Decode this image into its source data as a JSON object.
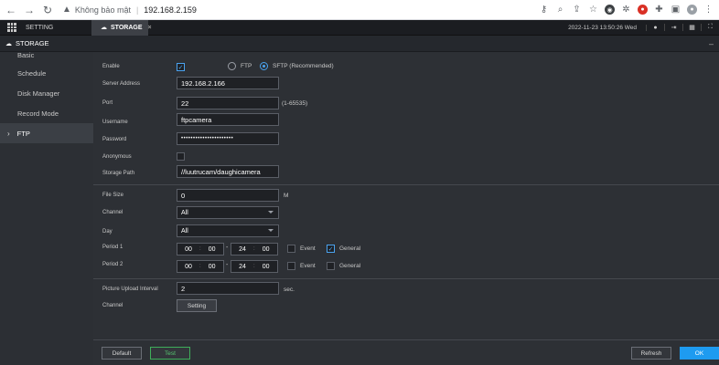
{
  "browser": {
    "security_label": "Không bảo mật",
    "url": "192.168.2.159",
    "icons": [
      "back-icon",
      "forward-icon",
      "reload-icon",
      "warning-icon",
      "key-icon",
      "zoom-icon",
      "share-icon",
      "star-icon",
      "extension-icon",
      "puzzle-icon",
      "sidepanel-icon",
      "profile-icon",
      "menu-icon"
    ]
  },
  "app": {
    "tabs": [
      {
        "label": "SETTING"
      },
      {
        "label": "STORAGE",
        "close": "×"
      }
    ],
    "datetime": "2022-11-23 13:50:26 Wed",
    "page_title": "STORAGE"
  },
  "sidebar": {
    "items": [
      {
        "label": "Basic"
      },
      {
        "label": "Schedule"
      },
      {
        "label": "Disk Manager"
      },
      {
        "label": "Record Mode"
      },
      {
        "label": "FTP"
      }
    ]
  },
  "form": {
    "enable_label": "Enable",
    "ftp_label": "FTP",
    "sftp_label": "SFTP (Recommended)",
    "server_label": "Server Address",
    "server_value": "192.168.2.166",
    "port_label": "Port",
    "port_value": "22",
    "port_hint": "(1-65535)",
    "username_label": "Username",
    "username_value": "ftpcamera",
    "password_label": "Password",
    "password_value": "••••••••••••••••••••••",
    "anonymous_label": "Anonymous",
    "storage_path_label": "Storage Path",
    "storage_path_value": "//luutrucam/daughicamera",
    "file_size_label": "File Size",
    "file_size_value": "0",
    "file_size_unit": "M",
    "channel_label": "Channel",
    "channel_value": "All",
    "day_label": "Day",
    "day_value": "All",
    "period1_label": "Period 1",
    "period2_label": "Period 2",
    "period_start": [
      "00",
      "00"
    ],
    "period_end": [
      "24",
      "00"
    ],
    "event_label": "Event",
    "general_label": "General",
    "upload_interval_label": "Picture Upload Interval",
    "upload_interval_value": "2",
    "upload_interval_unit": "sec.",
    "channel2_label": "Channel",
    "setting_button": "Setting"
  },
  "footer": {
    "default_label": "Default",
    "test_label": "Test",
    "refresh_label": "Refresh",
    "ok_label": "OK"
  },
  "colors": {
    "accent": "#1e9bf0",
    "test_green": "#56c470",
    "background": "#2d3035"
  }
}
